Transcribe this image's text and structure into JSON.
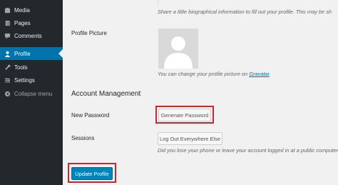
{
  "sidebar": {
    "items": [
      {
        "label": "Media",
        "icon": "media-icon"
      },
      {
        "label": "Pages",
        "icon": "pages-icon"
      },
      {
        "label": "Comments",
        "icon": "comments-icon"
      },
      {
        "label": "Profile",
        "icon": "profile-icon",
        "active": true
      },
      {
        "label": "Tools",
        "icon": "tools-icon"
      },
      {
        "label": "Settings",
        "icon": "settings-icon"
      }
    ],
    "collapse_label": "Collapse menu"
  },
  "profile": {
    "bio_description": "Share a little biographical information to fill out your profile. This may be sh",
    "picture_label": "Profile Picture",
    "picture_desc_prefix": "You can change your profile picture on ",
    "picture_desc_link": "Gravatar",
    "picture_desc_suffix": "."
  },
  "account": {
    "heading": "Account Management",
    "new_password_label": "New Password",
    "generate_password_button": "Generate Password",
    "sessions_label": "Sessions",
    "logout_everywhere_button": "Log Out Everywhere Else",
    "sessions_desc": "Did you lose your phone or leave your account logged in at a public computer"
  },
  "actions": {
    "update_profile_button": "Update Profile"
  },
  "colors": {
    "sidebar_bg": "#23282d",
    "active_bg": "#0073aa",
    "primary_button": "#0085ba",
    "highlight_border": "#c5282f"
  }
}
